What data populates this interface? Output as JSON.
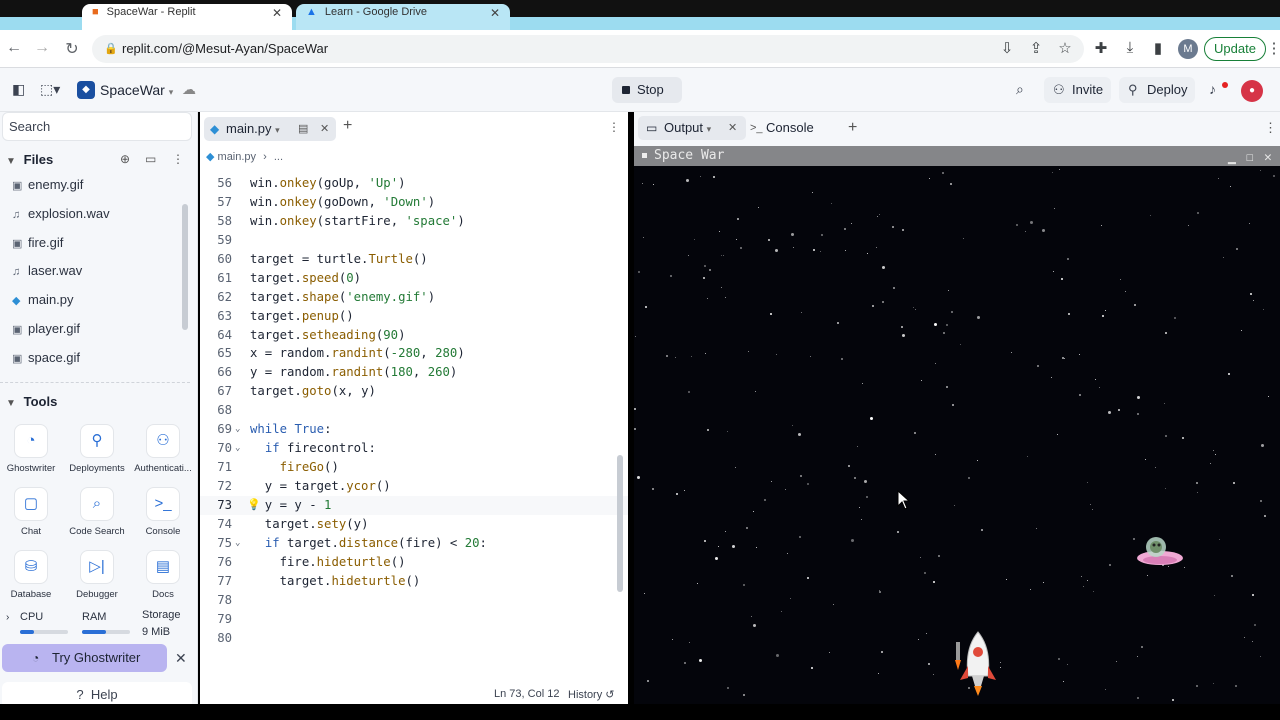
{
  "browser": {
    "tabs": [
      {
        "title": "SpaceWar - Replit"
      },
      {
        "title": "Learn - Google Drive"
      }
    ],
    "url": "replit.com/@Mesut-Ayan/SpaceWar",
    "profile_initial": "M",
    "update_label": "Update"
  },
  "header": {
    "project_name": "SpaceWar",
    "stop_label": "Stop",
    "invite_label": "Invite",
    "deploy_label": "Deploy"
  },
  "sidebar": {
    "search_placeholder": "Search",
    "files_title": "Files",
    "files": [
      {
        "name": "enemy.gif",
        "icon": "image-icon"
      },
      {
        "name": "explosion.wav",
        "icon": "music-icon"
      },
      {
        "name": "fire.gif",
        "icon": "image-icon"
      },
      {
        "name": "laser.wav",
        "icon": "music-icon"
      },
      {
        "name": "main.py",
        "icon": "python-icon"
      },
      {
        "name": "player.gif",
        "icon": "image-icon"
      },
      {
        "name": "space.gif",
        "icon": "image-icon"
      }
    ],
    "tools_title": "Tools",
    "tools": [
      {
        "label": "Ghostwriter",
        "icon": "ghostwriter-icon"
      },
      {
        "label": "Deployments",
        "icon": "deployments-icon"
      },
      {
        "label": "Authenticati...",
        "icon": "user-icon"
      },
      {
        "label": "Chat",
        "icon": "chat-icon"
      },
      {
        "label": "Code Search",
        "icon": "search-icon"
      },
      {
        "label": "Console",
        "icon": "terminal-icon"
      },
      {
        "label": "Database",
        "icon": "database-icon"
      },
      {
        "label": "Debugger",
        "icon": "debugger-icon"
      },
      {
        "label": "Docs",
        "icon": "docs-icon"
      }
    ],
    "resources": {
      "cpu_label": "CPU",
      "cpu_level": 0.3,
      "ram_label": "RAM",
      "ram_level": 0.5,
      "storage_label": "Storage",
      "storage_value": "9 MiB"
    },
    "ghostwriter_button": "Try Ghostwriter",
    "help_label": "Help"
  },
  "editor": {
    "tab_label": "main.py",
    "breadcrumb_file": "main.py",
    "breadcrumb_more": "...",
    "lines": [
      {
        "n": "56",
        "text": "win.onkey(goUp, 'Up')"
      },
      {
        "n": "57",
        "text": "win.onkey(goDown, 'Down')"
      },
      {
        "n": "58",
        "text": "win.onkey(startFire, 'space')"
      },
      {
        "n": "59",
        "text": ""
      },
      {
        "n": "60",
        "text": "target = turtle.Turtle()"
      },
      {
        "n": "61",
        "text": "target.speed(0)"
      },
      {
        "n": "62",
        "text": "target.shape('enemy.gif')"
      },
      {
        "n": "63",
        "text": "target.penup()"
      },
      {
        "n": "64",
        "text": "target.setheading(90)"
      },
      {
        "n": "65",
        "text": "x = random.randint(-280, 280)"
      },
      {
        "n": "66",
        "text": "y = random.randint(180, 260)"
      },
      {
        "n": "67",
        "text": "target.goto(x, y)"
      },
      {
        "n": "68",
        "text": ""
      },
      {
        "n": "69",
        "text": "while True:"
      },
      {
        "n": "70",
        "text": "  if firecontrol:"
      },
      {
        "n": "71",
        "text": "    fireGo()"
      },
      {
        "n": "72",
        "text": "  y = target.ycor()"
      },
      {
        "n": "73",
        "text": "  y = y - 1"
      },
      {
        "n": "74",
        "text": "  target.sety(y)"
      },
      {
        "n": "75",
        "text": "  if target.distance(fire) < 20:"
      },
      {
        "n": "76",
        "text": "    fire.hideturtle()"
      },
      {
        "n": "77",
        "text": "    target.hideturtle()"
      },
      {
        "n": "78",
        "text": ""
      },
      {
        "n": "79",
        "text": ""
      },
      {
        "n": "80",
        "text": ""
      }
    ],
    "status_position": "Ln 73, Col 12",
    "history_label": "History"
  },
  "output": {
    "tab_output": "Output",
    "tab_console": "Console",
    "window_title": "Space War"
  },
  "colors": {
    "accent": "#2a6fd6",
    "ghostwriter_bg": "#b9b4f0",
    "space_bg": "#04050b",
    "browser_tabbar": "#9cdcf0"
  }
}
